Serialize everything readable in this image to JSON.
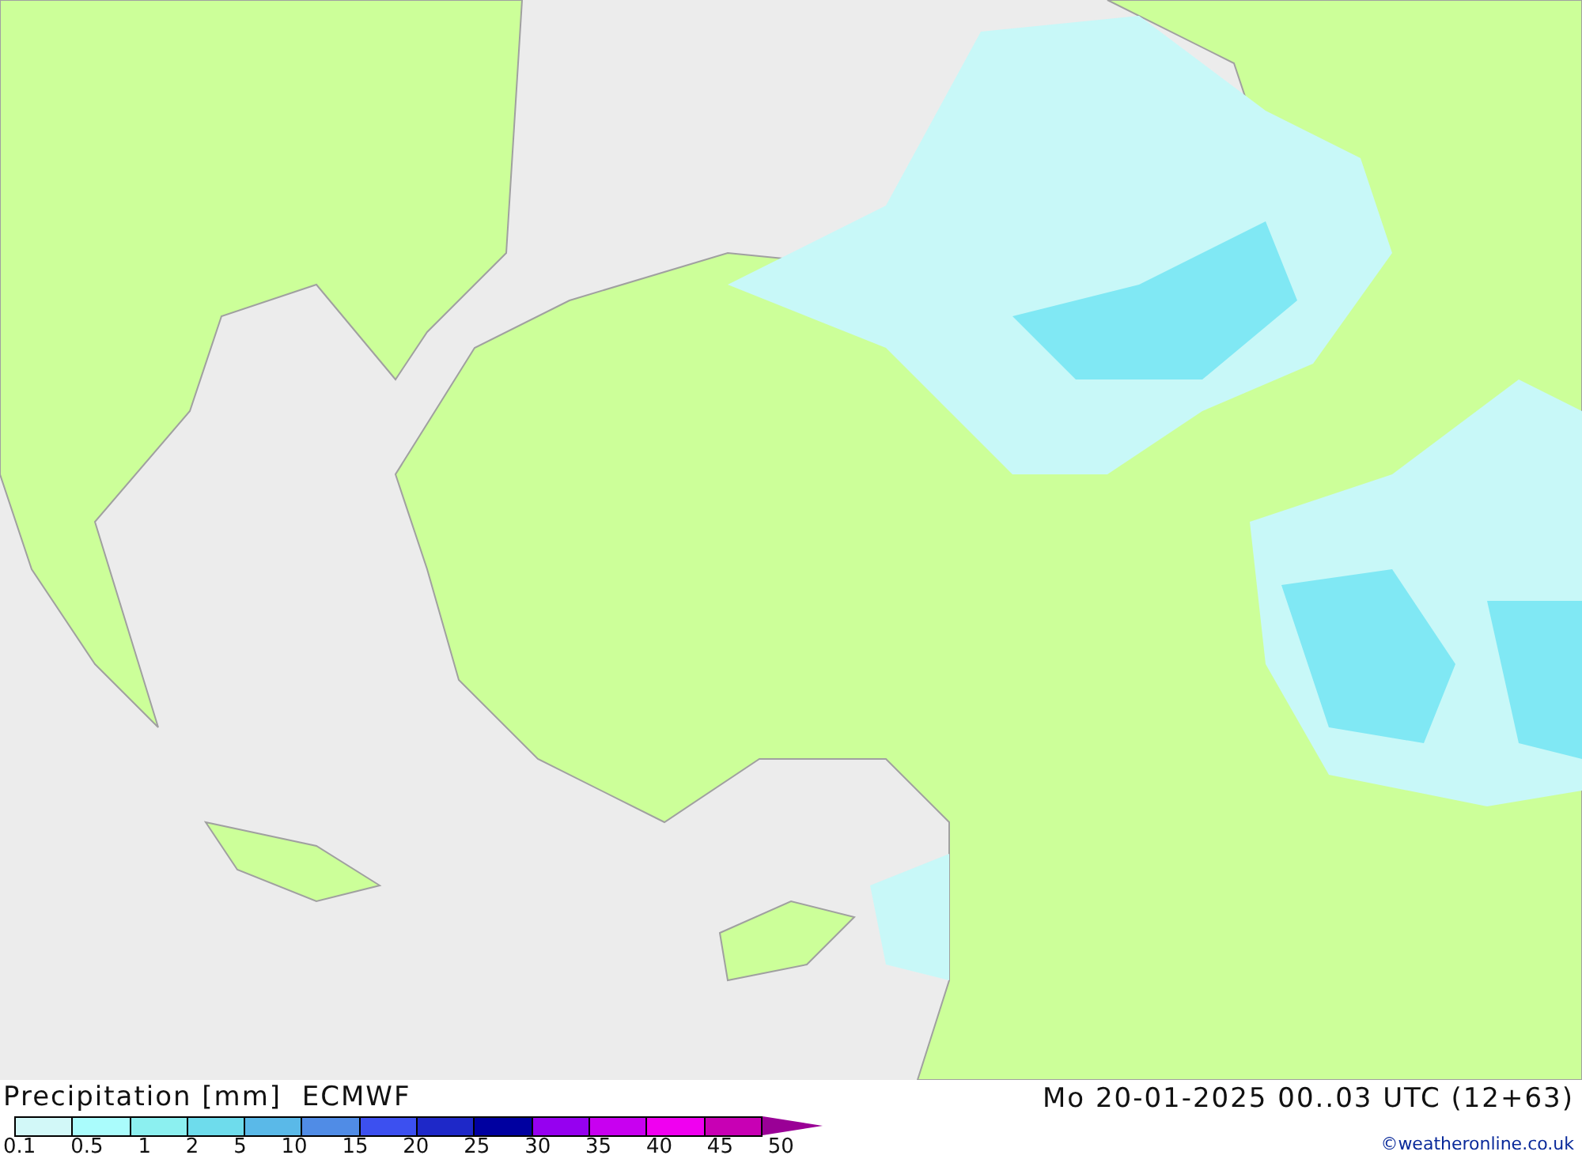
{
  "title": "Precipitation [mm]  ECMWF",
  "timestamp": "Mo 20-01-2025 00..03 UTC (12+63)",
  "credit": "©weatheronline.co.uk",
  "legend": {
    "bins": [
      {
        "color": "#d2f8f8"
      },
      {
        "color": "#aafcfc"
      },
      {
        "color": "#8cf0f0"
      },
      {
        "color": "#6edcec"
      },
      {
        "color": "#5ab9e8"
      },
      {
        "color": "#508ce6"
      },
      {
        "color": "#3c50f0"
      },
      {
        "color": "#1e28c8"
      },
      {
        "color": "#0000a0"
      },
      {
        "color": "#9600f0"
      },
      {
        "color": "#c800f0"
      },
      {
        "color": "#f000f0"
      },
      {
        "color": "#c800b4"
      },
      {
        "color": "#9a0096",
        "kind": "arrow"
      }
    ],
    "labels": [
      "0.1",
      "0.5",
      "1",
      "2",
      "5",
      "10",
      "15",
      "20",
      "25",
      "30",
      "35",
      "40",
      "45",
      "50"
    ]
  }
}
